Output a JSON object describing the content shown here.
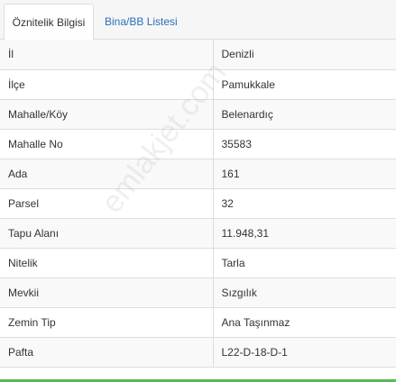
{
  "tabs": [
    {
      "label": "Öznitelik Bilgisi",
      "active": true
    },
    {
      "label": "Bina/BB Listesi",
      "active": false
    }
  ],
  "rows": [
    {
      "key": "İl",
      "value": "Denizli"
    },
    {
      "key": "İlçe",
      "value": "Pamukkale"
    },
    {
      "key": "Mahalle/Köy",
      "value": "Belenardıç"
    },
    {
      "key": "Mahalle No",
      "value": "35583"
    },
    {
      "key": "Ada",
      "value": "161"
    },
    {
      "key": "Parsel",
      "value": "32"
    },
    {
      "key": "Tapu Alanı",
      "value": "11.948,31"
    },
    {
      "key": "Nitelik",
      "value": "Tarla"
    },
    {
      "key": "Mevkii",
      "value": "Sızgılık"
    },
    {
      "key": "Zemin Tip",
      "value": "Ana Taşınmaz"
    },
    {
      "key": "Pafta",
      "value": "L22-D-18-D-1"
    }
  ],
  "watermark": "emlakjet.com",
  "colors": {
    "link": "#2a6ebb",
    "accent_bar": "#5cb85c",
    "border": "#dddddd"
  }
}
